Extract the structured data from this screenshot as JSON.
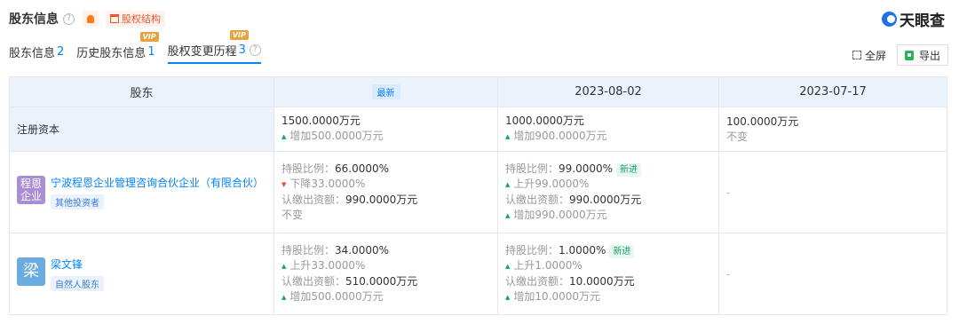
{
  "header": {
    "title": "股东信息",
    "struct_label": "股权结构",
    "logo": "天眼查"
  },
  "tabs": [
    {
      "label": "股东信息",
      "count": "2"
    },
    {
      "label": "历史股东信息",
      "count": "1",
      "vip": "VIP"
    },
    {
      "label": "股权变更历程",
      "count": "3",
      "vip": "VIP"
    }
  ],
  "tools": {
    "fullscreen": "全屏",
    "export": "导出"
  },
  "table": {
    "col_holder": "股东",
    "col_latest_badge": "最新",
    "col_date1": "2023-08-02",
    "col_date2": "2023-07-17",
    "capital": {
      "label": "注册资本",
      "latest": {
        "value": "1500.0000万元",
        "change": "增加500.0000万元"
      },
      "d1": {
        "value": "1000.0000万元",
        "change": "增加900.0000万元"
      },
      "d2": {
        "value": "100.0000万元",
        "change": "不变"
      }
    },
    "rows": [
      {
        "avatar": "程恩企业",
        "name": "宁波程恩企业管理咨询合伙企业（有限合伙）",
        "tag": "其他投资者",
        "latest": {
          "ratio_label": "持股比例：",
          "ratio": "66.0000%",
          "ratio_change": "下降33.0000%",
          "amount_label": "认缴出资额：",
          "amount": "990.0000万元",
          "amount_change": "不变"
        },
        "d1": {
          "ratio_label": "持股比例：",
          "ratio": "99.0000%",
          "badge": "新进",
          "ratio_change": "上升99.0000%",
          "amount_label": "认缴出资额：",
          "amount": "990.0000万元",
          "amount_change": "增加990.0000万元"
        },
        "d2": "-"
      },
      {
        "avatar": "梁",
        "name": "梁文锋",
        "tag": "自然人股东",
        "latest": {
          "ratio_label": "持股比例：",
          "ratio": "34.0000%",
          "ratio_change": "上升33.0000%",
          "amount_label": "认缴出资额：",
          "amount": "510.0000万元",
          "amount_change": "增加500.0000万元"
        },
        "d1": {
          "ratio_label": "持股比例：",
          "ratio": "1.0000%",
          "badge": "新进",
          "ratio_change": "上升1.0000%",
          "amount_label": "认缴出资额：",
          "amount": "10.0000万元",
          "amount_change": "增加10.0000万元"
        },
        "d2": "-"
      }
    ]
  }
}
